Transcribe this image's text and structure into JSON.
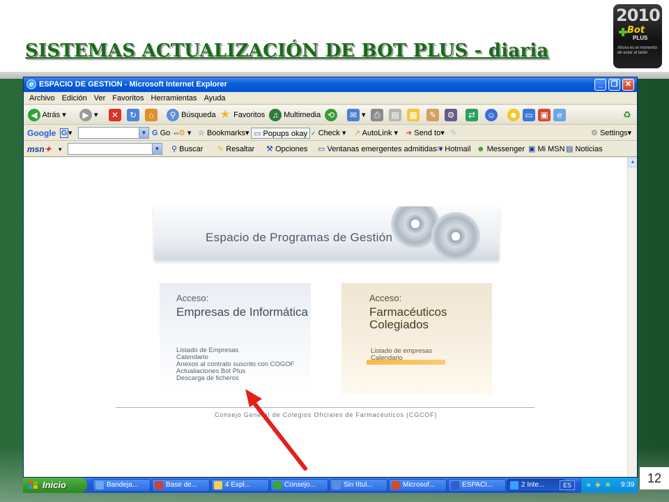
{
  "slide": {
    "title": "SISTEMAS ACTUALIZACIÓN DE BOT PLUS - diaria",
    "page_number": "12",
    "logo": {
      "year": "2010",
      "brand": "Bot",
      "brand_suffix": "PLUS",
      "tagline": "Ahora es el momento de estar al tanto"
    }
  },
  "ie": {
    "title": "ESPACIO DE GESTION - Microsoft Internet Explorer",
    "menu": [
      "Archivo",
      "Edición",
      "Ver",
      "Favoritos",
      "Herramientas",
      "Ayuda"
    ],
    "toolbar": {
      "back": "Atrás",
      "search": "Búsqueda",
      "favorites": "Favoritos",
      "multimedia": "Multimedia"
    },
    "google_bar": {
      "brand": "Google",
      "go": "Go",
      "bookmarks": "Bookmarks▾",
      "popups": "Popups okay",
      "check": "Check",
      "autolink": "AutoLink",
      "sendto": "Send to▾",
      "settings": "Settings▾"
    },
    "msn_bar": {
      "brand": "msn",
      "buscar": "Buscar",
      "resaltar": "Resaltar",
      "opciones": "Opciones",
      "ventanas": "Ventanas emergentes admitidas",
      "hotmail": "Hotmail",
      "messenger": "Messenger",
      "mimsn": "Mi MSN",
      "noticias": "Noticias"
    },
    "content": {
      "banner": "Espacio de Programas de Gestión",
      "left_panel": {
        "acceso": "Acceso:",
        "title": "Empresas de Informática",
        "links": [
          "Listado de Empresas",
          "Calendario",
          "Anexos al contrato suscrito con COGOF",
          "Actualiaciones Bot Plus",
          "Descarga de ficheros"
        ]
      },
      "right_panel": {
        "acceso": "Acceso:",
        "title": "Farmacéuticos Colegiados",
        "links": [
          "Listado de empresas",
          "Calendario"
        ]
      },
      "footer": "Consejo General de Colegios Oficiales de Farmacéuticos (CGCOF)"
    }
  },
  "taskbar": {
    "start": "Inicio",
    "tasks": [
      {
        "label": "Bandeja...",
        "color": "#6aa8f0"
      },
      {
        "label": "Base de...",
        "color": "#c9423a"
      },
      {
        "label": "4 Expl...",
        "color": "#f4cf5a"
      },
      {
        "label": "Consejo...",
        "color": "#3aa63a"
      },
      {
        "label": "Sin títul...",
        "color": "#5a8fe0"
      },
      {
        "label": "Microsof...",
        "color": "#d24a2c"
      },
      {
        "label": "ESPACI...",
        "color": "#2f5fc8"
      },
      {
        "label": "2 Inte...",
        "color": "#3aa0ff"
      }
    ],
    "lang": "ES",
    "clock": "9:39"
  },
  "colors": {
    "title_green": "#1a6b1a",
    "background_green": "#1f5b30",
    "arrow_red": "#e3201b"
  }
}
